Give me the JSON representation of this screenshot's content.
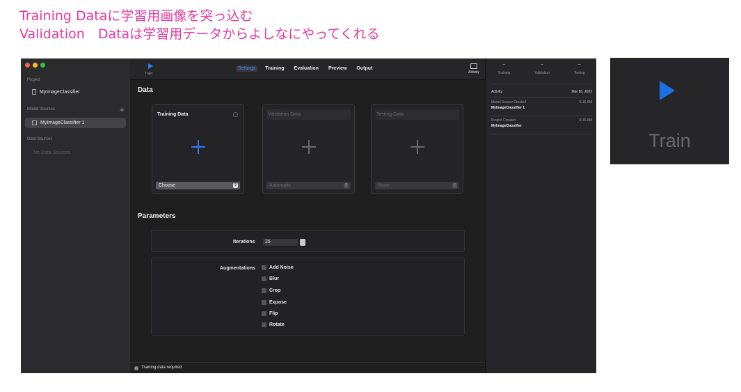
{
  "caption": {
    "line1": "Training Dataに学習用画像を突っ込む",
    "line2": "Validation　Dataは学習用データからよしなにやってくれる"
  },
  "sidebar": {
    "project_header": "Project",
    "project_item": "MyImageClassifier",
    "model_sources_header": "Model Sources",
    "model_source_item": "MyImageClassifier 1",
    "data_sources_header": "Data Sources",
    "data_sources_empty": "No Data Sources"
  },
  "toolbar": {
    "train_label": "Train",
    "tabs": [
      "Settings",
      "Training",
      "Evaluation",
      "Preview",
      "Output"
    ],
    "selected_tab": "Settings",
    "activity_label": "Activity"
  },
  "data_section": {
    "title": "Data",
    "cards": [
      {
        "title": "Training Data",
        "select": "Choose"
      },
      {
        "title": "Validation Data",
        "select": "Automatic"
      },
      {
        "title": "Testing Data",
        "select": "None"
      }
    ]
  },
  "parameters": {
    "title": "Parameters",
    "iterations_label": "Iterations",
    "iterations_value": "25",
    "augmentations_label": "Augmentations",
    "augmentations": [
      "Add Noise",
      "Blur",
      "Crop",
      "Expose",
      "Flip",
      "Rotate"
    ]
  },
  "status": {
    "text": "Training data required"
  },
  "right_panel": {
    "tabs": [
      {
        "value": "--",
        "label": "Training"
      },
      {
        "value": "--",
        "label": "Validation"
      },
      {
        "value": "--",
        "label": "Testing"
      }
    ],
    "activity_header": "Activity",
    "activity_date": "Mar 28, 2022",
    "entries": [
      {
        "event": "Model Source Created",
        "name": "MyImageClassifier 1",
        "time": "6:16 AM"
      },
      {
        "event": "Project Created",
        "name": "MyImageClassifier",
        "time": "6:16 AM"
      }
    ]
  },
  "zoom": {
    "label": "Train"
  },
  "colors": {
    "caption": "#e8389a",
    "accent": "#2f7ef0",
    "window_bg": "#1e1e1f"
  }
}
